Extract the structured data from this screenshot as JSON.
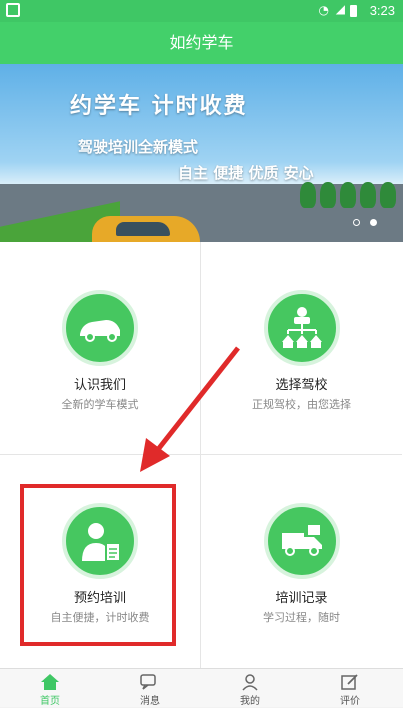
{
  "status_bar": {
    "time": "3:23"
  },
  "header": {
    "title": "如约学车"
  },
  "banner": {
    "headline": "约学车 计时收费",
    "subline_1": "驾驶培训全新模式",
    "subline_2": "自主 便捷 优质 安心",
    "dots": {
      "count": 2,
      "active_index": 1
    }
  },
  "features": [
    {
      "title": "认识我们",
      "desc": "全新的学车模式",
      "icon": "car-icon"
    },
    {
      "title": "选择驾校",
      "desc": "正规驾校，由您选择",
      "icon": "org-chart-icon"
    },
    {
      "title": "预约培训",
      "desc": "自主便捷，计时收费",
      "icon": "person-document-icon"
    },
    {
      "title": "培训记录",
      "desc": "学习过程，随时",
      "icon": "truck-icon"
    }
  ],
  "tabs": [
    {
      "label": "首页",
      "icon": "home-icon",
      "active": true
    },
    {
      "label": "消息",
      "icon": "chat-icon",
      "active": false
    },
    {
      "label": "我的",
      "icon": "user-icon",
      "active": false
    },
    {
      "label": "评价",
      "icon": "edit-icon",
      "active": false
    }
  ],
  "colors": {
    "primary_green": "#43d06a",
    "highlight_red": "#e02a2a"
  }
}
